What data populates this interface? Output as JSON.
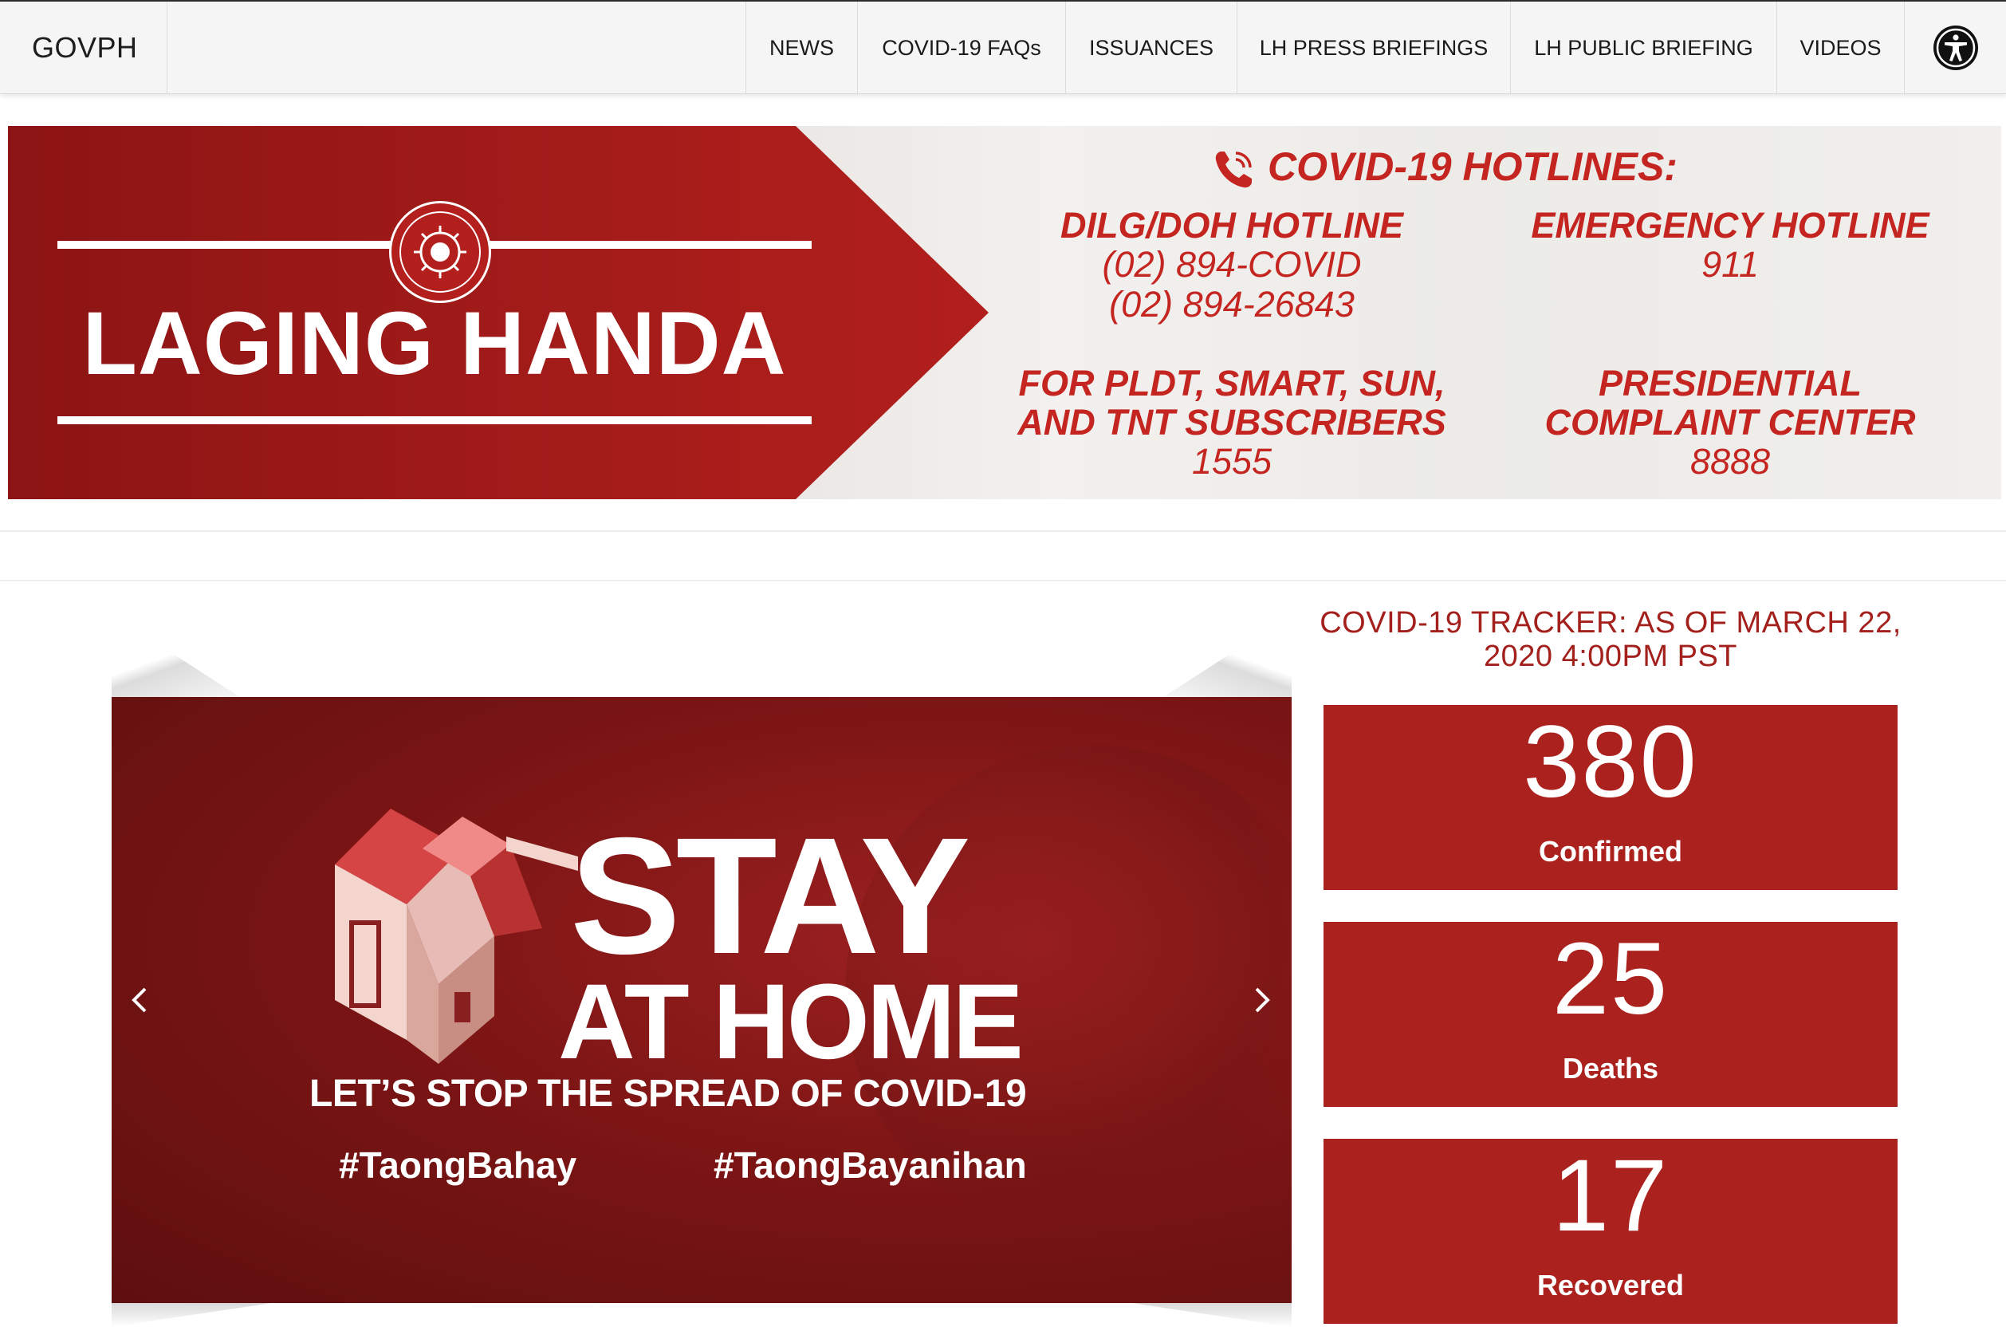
{
  "nav": {
    "brand": "GOVPH",
    "items": [
      {
        "label": "NEWS"
      },
      {
        "label": "COVID-19 FAQs"
      },
      {
        "label": "ISSUANCES"
      },
      {
        "label": "LH PRESS BRIEFINGS"
      },
      {
        "label": "LH PUBLIC BRIEFING"
      },
      {
        "label": "VIDEOS"
      }
    ],
    "accessibility_icon": "accessibility-icon"
  },
  "banner": {
    "title": "LAGING HANDA",
    "seal_icon": "presidential-communications-seal-icon",
    "hotlines_title": "COVID-19 HOTLINES:",
    "phone_icon": "phone-icon",
    "blocks": [
      {
        "heading": [
          "DILG/DOH HOTLINE"
        ],
        "numbers": [
          "(02) 894-COVID",
          "(02) 894-26843"
        ]
      },
      {
        "heading": [
          "EMERGENCY HOTLINE"
        ],
        "numbers": [
          "911"
        ]
      },
      {
        "heading": [
          "FOR PLDT, SMART, SUN,",
          "AND TNT SUBSCRIBERS"
        ],
        "numbers": [
          "1555"
        ]
      },
      {
        "heading": [
          "PRESIDENTIAL",
          "COMPLAINT CENTER"
        ],
        "numbers": [
          "8888"
        ]
      }
    ],
    "colors": {
      "red": "#ab211d",
      "hotline_text": "#c42520"
    }
  },
  "carousel": {
    "prev_icon": "chevron-left-icon",
    "next_icon": "chevron-right-icon",
    "slide": {
      "headline_1": "STAY",
      "headline_2": "AT HOME",
      "subline": "LET’S STOP THE SPREAD OF COVID-19",
      "hashtag_1": "#TaongBahay",
      "hashtag_2": "#TaongBayanihan",
      "house_icon": "house-icon"
    }
  },
  "tracker": {
    "title": "COVID-19 TRACKER: AS OF MARCH 22, 2020 4:00PM PST",
    "stats": [
      {
        "value": "380",
        "label": "Confirmed"
      },
      {
        "value": "25",
        "label": "Deaths"
      },
      {
        "value": "17",
        "label": "Recovered"
      }
    ]
  }
}
